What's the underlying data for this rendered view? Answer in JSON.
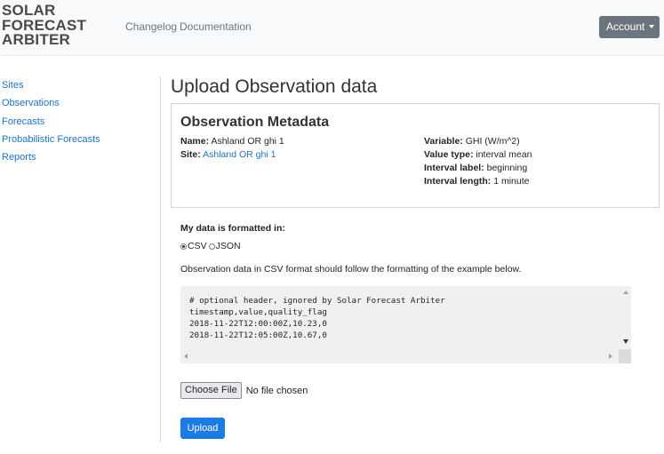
{
  "brand": {
    "line1": "SOLAR",
    "line2": "FORECAST",
    "line3": "ARBITER"
  },
  "nav": {
    "changelog": "Changelog",
    "documentation": "Documentation",
    "account": "Account"
  },
  "sidebar": {
    "items": [
      {
        "label": "Sites"
      },
      {
        "label": "Observations"
      },
      {
        "label": "Forecasts"
      },
      {
        "label": "Probabilistic Forecasts"
      },
      {
        "label": "Reports"
      }
    ]
  },
  "page": {
    "title": "Upload Observation data"
  },
  "metadata": {
    "title": "Observation Metadata",
    "name_label": "Name:",
    "name_value": "Ashland OR ghi 1",
    "site_label": "Site:",
    "site_value": "Ashland OR ghi 1",
    "variable_label": "Variable:",
    "variable_value": "GHI (W/m^2)",
    "value_type_label": "Value type:",
    "value_type_value": "interval mean",
    "interval_label_label": "Interval label:",
    "interval_label_value": "beginning",
    "interval_length_label": "Interval length:",
    "interval_length_value": "1 minute"
  },
  "format": {
    "label": "My data is formatted in:",
    "options": [
      "CSV",
      "JSON"
    ],
    "selected": "CSV",
    "help": "Observation data in CSV format should follow the formatting of the example below."
  },
  "example": {
    "lines": [
      "# optional header, ignored by Solar Forecast Arbiter",
      "timestamp,value,quality_flag",
      "2018-11-22T12:00:00Z,10.23,0",
      "2018-11-22T12:05:00Z,10.67,0"
    ]
  },
  "file": {
    "button": "Choose File",
    "status": "No file chosen"
  },
  "upload": {
    "label": "Upload"
  }
}
